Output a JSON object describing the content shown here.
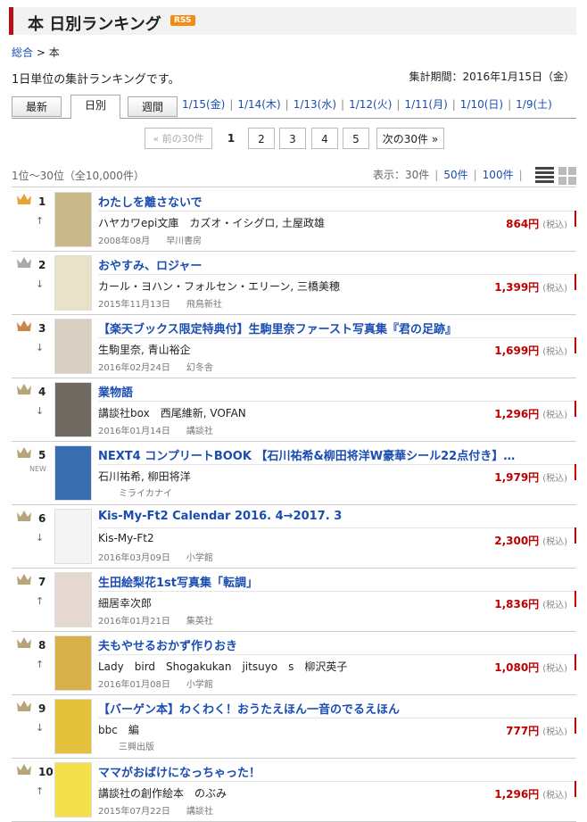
{
  "header": {
    "title": "本 日別ランキング",
    "rss": "RSS"
  },
  "breadcrumb": {
    "home": "総合",
    "sep": ">",
    "current": "本"
  },
  "description": "1日単位の集計ランキングです。",
  "period": "集計期間：2016年1月15日（金）",
  "tabs": {
    "latest": "最新",
    "daily": "日別",
    "weekly": "週間"
  },
  "day_links": [
    "1/15(金)",
    "1/14(木)",
    "1/13(水)",
    "1/12(火)",
    "1/11(月)",
    "1/10(日)",
    "1/9(土)"
  ],
  "pager": {
    "prev": "« 前の30件",
    "current": "1",
    "pages": [
      "2",
      "3",
      "4",
      "5"
    ],
    "next": "次の30件 »"
  },
  "count_text": "1位〜30位（全10,000件）",
  "display": {
    "label": "表示：",
    "current": "30件",
    "opt2": "50件",
    "opt3": "100件",
    "sep": "|"
  },
  "colors": {
    "gold": "#e8a23a",
    "silver": "#a9a9a9",
    "bronze": "#c8874b",
    "small": "#b8a47a",
    "price": "#bf0000",
    "link": "#1a4db2",
    "accent": "#b4101a"
  },
  "items": [
    {
      "rank": "1",
      "arrow": "↑",
      "crown": "gold",
      "title": "わたしを離さないで",
      "authors": "ハヤカワepi文庫　カズオ・イシグロ, 土屋政雄",
      "date": "2008年08月",
      "publisher": "早川書房",
      "price": "864円",
      "tax": "(税込)"
    },
    {
      "rank": "2",
      "arrow": "↓",
      "crown": "silver",
      "title": "おやすみ、ロジャー",
      "authors": "カール・ヨハン・フォルセン・エリーン, 三橋美穂",
      "date": "2015年11月13日",
      "publisher": "飛鳥新社",
      "price": "1,399円",
      "tax": "(税込)"
    },
    {
      "rank": "3",
      "arrow": "↓",
      "crown": "bronze",
      "title": "【楽天ブックス限定特典付】生駒里奈ファースト写真集『君の足跡』",
      "authors": "生駒里奈, 青山裕企",
      "date": "2016年02月24日",
      "publisher": "幻冬舎",
      "price": "1,699円",
      "tax": "(税込)"
    },
    {
      "rank": "4",
      "arrow": "↓",
      "crown": "small",
      "title": "業物語",
      "authors": "講談社box　西尾維新, VOFAN",
      "date": "2016年01月14日",
      "publisher": "講談社",
      "price": "1,296円",
      "tax": "(税込)"
    },
    {
      "rank": "5",
      "arrow": "NEW",
      "crown": "small",
      "title": "NEXT4 コンプリートBOOK 【石川祐希&柳田将洋W豪華シール22点付き】…",
      "authors": "石川祐希, 柳田将洋",
      "date": "",
      "publisher": "ミライカナイ",
      "price": "1,979円",
      "tax": "(税込)"
    },
    {
      "rank": "6",
      "arrow": "↓",
      "crown": "small",
      "title": "Kis-My-Ft2 Calendar 2016. 4→2017. 3",
      "authors": "Kis-My-Ft2",
      "date": "2016年03月09日",
      "publisher": "小学館",
      "price": "2,300円",
      "tax": "(税込)"
    },
    {
      "rank": "7",
      "arrow": "↑",
      "crown": "small",
      "title": "生田絵梨花1st写真集「転調」",
      "authors": "細居幸次郎",
      "date": "2016年01月21日",
      "publisher": "集英社",
      "price": "1,836円",
      "tax": "(税込)"
    },
    {
      "rank": "8",
      "arrow": "↑",
      "crown": "small",
      "title": "夫もやせるおかず作りおき",
      "authors": "Lady　bird　Shogakukan　jitsuyo　s　柳沢英子",
      "date": "2016年01月08日",
      "publisher": "小学館",
      "price": "1,080円",
      "tax": "(税込)"
    },
    {
      "rank": "9",
      "arrow": "↓",
      "crown": "small",
      "title": "【バーゲン本】わくわく！おうたえほん一音のでるえほん",
      "authors": "bbc　編",
      "date": "",
      "publisher": "三興出版",
      "price": "777円",
      "tax": "(税込)"
    },
    {
      "rank": "10",
      "arrow": "↑",
      "crown": "small",
      "title": "ママがおばけになっちゃった！",
      "authors": "講談社の創作絵本　のぶみ",
      "date": "2015年07月22日",
      "publisher": "講談社",
      "price": "1,296円",
      "tax": "(税込)"
    }
  ]
}
